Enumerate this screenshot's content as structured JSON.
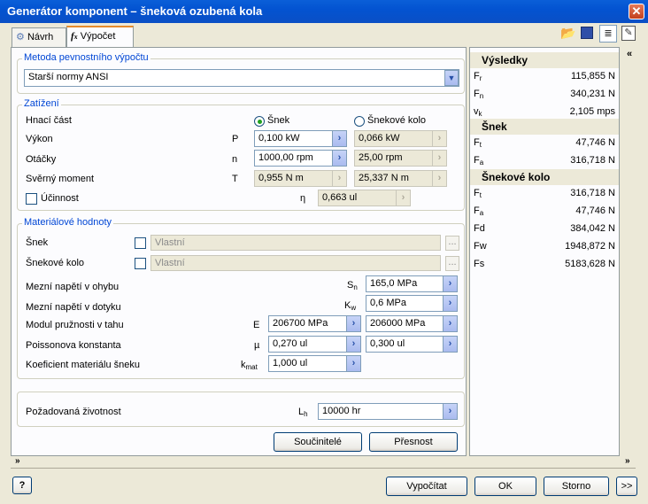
{
  "window": {
    "title": "Generátor komponent – šneková ozubená kola",
    "close_icon": "close-icon"
  },
  "tabs": [
    {
      "label": "Návrh"
    },
    {
      "label": "Výpočet"
    }
  ],
  "method": {
    "legend": "Metoda pevnostního výpočtu",
    "selected": "Starší normy ANSI"
  },
  "loads": {
    "legend": "Zatížení",
    "drive_label": "Hnací část",
    "radio_worm": "Šnek",
    "radio_wheel": "Šnekové kolo",
    "power": {
      "label": "Výkon",
      "sym": "P",
      "worm": "0,100 kW",
      "wheel": "0,066 kW"
    },
    "speed": {
      "label": "Otáčky",
      "sym": "n",
      "worm": "1000,00 rpm",
      "wheel": "25,00 rpm"
    },
    "torque": {
      "label": "Svěrný moment",
      "sym": "T",
      "worm": "0,955 N m",
      "wheel": "25,337 N m"
    },
    "efficiency": {
      "label": "Účinnost",
      "sym": "η",
      "value": "0,663 ul"
    }
  },
  "material": {
    "legend": "Materiálové hodnoty",
    "worm_label": "Šnek",
    "wheel_label": "Šnekové kolo",
    "worm_material": "Vlastní",
    "wheel_material": "Vlastní",
    "dots": "...",
    "bending": {
      "label": "Mezní napětí v ohybu",
      "sym": "S",
      "sub": "n",
      "value": "165,0 MPa"
    },
    "contact": {
      "label": "Mezní napětí v dotyku",
      "sym": "K",
      "sub": "w",
      "value": "0,6 MPa"
    },
    "modulus": {
      "label": "Modul pružnosti v tahu",
      "sym": "E",
      "worm": "206700 MPa",
      "wheel": "206000 MPa"
    },
    "poisson": {
      "label": "Poissonova konstanta",
      "sym": "µ",
      "worm": "0,270 ul",
      "wheel": "0,300 ul"
    },
    "coef": {
      "label": "Koeficient materiálu šneku",
      "sym": "k",
      "sub": "mat",
      "value": "1,000 ul"
    }
  },
  "life": {
    "label": "Požadovaná životnost",
    "sym": "L",
    "sub": "h",
    "value": "10000 hr"
  },
  "buttons": {
    "factors": "Součinitelé",
    "accuracy": "Přesnost",
    "calculate": "Vypočítat",
    "ok": "OK",
    "cancel": "Storno",
    "more": ">>",
    "help": "?"
  },
  "results": {
    "header": "Výsledky",
    "rows1": [
      {
        "sym": "F",
        "sub": "r",
        "value": "115,855 N"
      },
      {
        "sym": "F",
        "sub": "n",
        "value": "340,231 N"
      },
      {
        "sym": "v",
        "sub": "k",
        "value": "2,105 mps"
      }
    ],
    "worm_header": "Šnek",
    "rows2": [
      {
        "sym": "F",
        "sub": "t",
        "value": "47,746 N"
      },
      {
        "sym": "F",
        "sub": "a",
        "value": "316,718 N"
      }
    ],
    "wheel_header": "Šnekové kolo",
    "rows3": [
      {
        "sym": "F",
        "sub": "t",
        "value": "316,718 N"
      },
      {
        "sym": "F",
        "sub": "a",
        "value": "47,746 N"
      },
      {
        "sym": "Fd",
        "sub": "",
        "value": "384,042 N"
      },
      {
        "sym": "Fw",
        "sub": "",
        "value": "1948,872 N"
      },
      {
        "sym": "Fs",
        "sub": "",
        "value": "5183,628 N"
      }
    ]
  }
}
